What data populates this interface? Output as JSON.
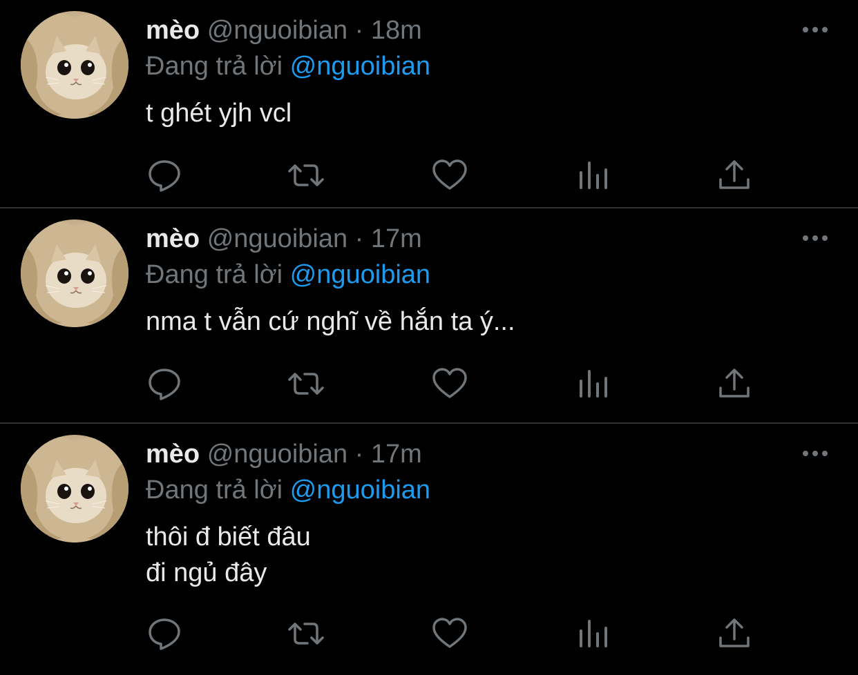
{
  "colors": {
    "background": "#000000",
    "divider": "#2f3336",
    "primary_text": "#e7e9ea",
    "secondary_text": "#71767b",
    "link": "#1d9bf0"
  },
  "icons": {
    "avatar": "cat-avatar",
    "more": "more-icon",
    "reply": "reply-icon",
    "retweet": "retweet-icon",
    "like": "heart-icon",
    "views": "views-icon",
    "share": "share-icon"
  },
  "tweets": [
    {
      "name": "mèo",
      "handle": "@nguoibian",
      "separator": "·",
      "time": "18m",
      "reply_prefix": "Đang trả lời",
      "reply_to": "@nguoibian",
      "text": "t ghét yjh vcl"
    },
    {
      "name": "mèo",
      "handle": "@nguoibian",
      "separator": "·",
      "time": "17m",
      "reply_prefix": "Đang trả lời",
      "reply_to": "@nguoibian",
      "text": "nma t vẫn cứ nghĩ về hắn ta ý..."
    },
    {
      "name": "mèo",
      "handle": "@nguoibian",
      "separator": "·",
      "time": "17m",
      "reply_prefix": "Đang trả lời",
      "reply_to": "@nguoibian",
      "text": "thôi đ biết đâu\nđi ngủ đây"
    }
  ]
}
